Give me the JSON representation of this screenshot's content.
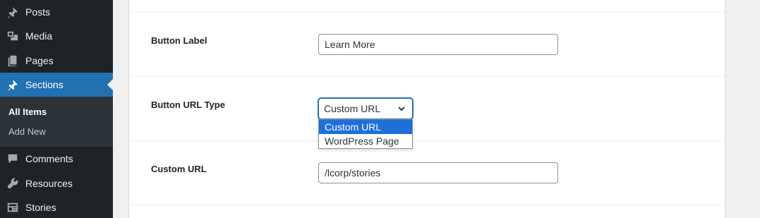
{
  "sidebar": {
    "items": [
      {
        "label": "Posts",
        "icon": "pin-icon"
      },
      {
        "label": "Media",
        "icon": "media-icon"
      },
      {
        "label": "Pages",
        "icon": "pages-icon"
      },
      {
        "label": "Sections",
        "icon": "pin-icon"
      },
      {
        "label": "Comments",
        "icon": "comment-icon"
      },
      {
        "label": "Resources",
        "icon": "wrench-icon"
      },
      {
        "label": "Stories",
        "icon": "stories-icon"
      }
    ],
    "submenu": [
      {
        "label": "All Items"
      },
      {
        "label": "Add New"
      }
    ],
    "colors": {
      "background": "#1d2327",
      "active": "#2271b1",
      "submenu_bg": "#2c3338"
    }
  },
  "form": {
    "button_label": {
      "label": "Button Label",
      "value": "Learn More"
    },
    "button_url_type": {
      "label": "Button URL Type",
      "value": "Custom URL",
      "options": [
        "Custom URL",
        "WordPress Page"
      ]
    },
    "custom_url": {
      "label": "Custom URL",
      "value": "/lcorp/stories"
    }
  }
}
